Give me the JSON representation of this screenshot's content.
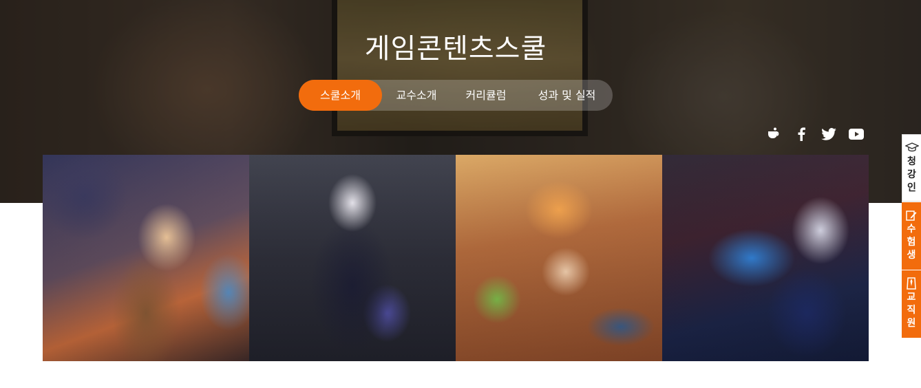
{
  "page": {
    "title": "게임콘텐츠스쿨"
  },
  "tabs": [
    {
      "label": "스쿨소개",
      "active": true
    },
    {
      "label": "교수소개",
      "active": false
    },
    {
      "label": "커리큘럼",
      "active": false
    },
    {
      "label": "성과 및 실적",
      "active": false
    }
  ],
  "social": [
    {
      "icon": "kakaostory-icon"
    },
    {
      "icon": "facebook-icon"
    },
    {
      "icon": "twitter-icon"
    },
    {
      "icon": "youtube-icon"
    }
  ],
  "gallery": [
    {
      "icon": "character-illustration-warrior-girl"
    },
    {
      "icon": "character-illustration-silver-hair-girl"
    },
    {
      "icon": "character-illustration-cartoon-girl"
    },
    {
      "icon": "character-illustration-sci-fi-gunner"
    }
  ],
  "side_menu": [
    {
      "label": "청강인",
      "icon": "graduation-cap-icon"
    },
    {
      "label": "수험생",
      "icon": "notepad-pencil-icon"
    },
    {
      "label": "교직원",
      "icon": "suit-tie-icon"
    }
  ],
  "colors": {
    "accent": "#f26c0d",
    "white": "#ffffff"
  }
}
